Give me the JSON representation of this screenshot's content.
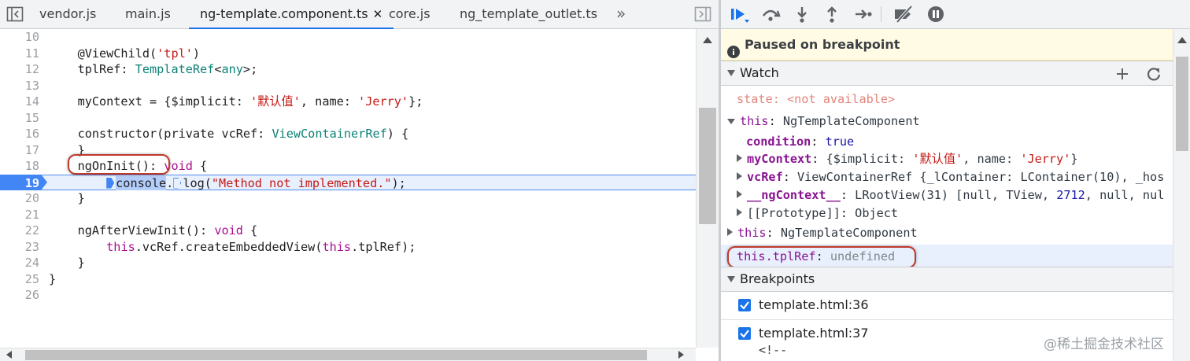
{
  "editor": {
    "tabs": [
      {
        "label": "vendor.js",
        "active": false
      },
      {
        "label": "main.js",
        "active": false
      },
      {
        "label": "ng-template.component.ts",
        "active": true
      },
      {
        "label": "core.js",
        "active": false
      },
      {
        "label": "ng_template_outlet.ts",
        "active": false
      }
    ],
    "tab_close_glyph": "✕",
    "more_tabs_glyph": "»",
    "lines": [
      {
        "n": "10"
      },
      {
        "n": "11"
      },
      {
        "n": "12"
      },
      {
        "n": "13"
      },
      {
        "n": "14"
      },
      {
        "n": "15"
      },
      {
        "n": "16"
      },
      {
        "n": "17"
      },
      {
        "n": "18"
      },
      {
        "n": "19"
      },
      {
        "n": "20"
      },
      {
        "n": "21"
      },
      {
        "n": "22"
      },
      {
        "n": "23"
      },
      {
        "n": "24"
      },
      {
        "n": "25"
      },
      {
        "n": "26"
      }
    ],
    "code": {
      "l11_a": "    @ViewChild(",
      "l11_b": "'tpl'",
      "l11_c": ")",
      "l12_a": "    tplRef: ",
      "l12_b": "TemplateRef",
      "l12_c": "<",
      "l12_d": "any",
      "l12_e": ">;",
      "l14_a": "    myContext = {$implicit: ",
      "l14_b": "'默认值'",
      "l14_c": ", name: ",
      "l14_d": "'Jerry'",
      "l14_e": "};",
      "l16_a": "    constructor(private vcRef: ",
      "l16_b": "ViewContainerRef",
      "l16_c": ") {",
      "l17": "    }",
      "l18_a": "    ngOnInit(): ",
      "l18_b": "void",
      "l18_c": " {",
      "l19_pre": "        ",
      "l19_a": "console",
      "l19_b": ".",
      "l19_c": "log(",
      "l19_d": "\"Method not implemented.\"",
      "l19_e": ");",
      "l20": "    }",
      "l22_a": "    ngAfterViewInit(): ",
      "l22_b": "void",
      "l22_c": " {",
      "l23_pre": "        ",
      "l23_a": "this",
      "l23_b": ".vcRef.createEmbeddedView(",
      "l23_c": "this",
      "l23_d": ".tplRef);",
      "l24": "    }",
      "l25": "}"
    },
    "current_line": "19"
  },
  "debugger": {
    "paused_text": "Paused on breakpoint",
    "watch_title": "Watch",
    "watch": {
      "state_name": "state",
      "state_value": "<not available>",
      "this1_name": "this",
      "this1_value": "NgTemplateComponent",
      "condition_name": "condition",
      "condition_value": "true",
      "mycontext_name": "myContext",
      "mycontext_a": "{$implicit: ",
      "mycontext_b": "'默认值'",
      "mycontext_c": ", name: ",
      "mycontext_d": "'Jerry'",
      "mycontext_e": "}",
      "vcref_name": "vcRef",
      "vcref_value": "ViewContainerRef {_lContainer: LContainer(10), _hos",
      "ngcontext_name": "__ngContext__",
      "ngcontext_a": "LRootView(31) [null, TView, ",
      "ngcontext_b": "2712",
      "ngcontext_c": ", null, nul",
      "proto_name": "[[Prototype]]",
      "proto_value": "Object",
      "this2_name": "this",
      "this2_value": "NgTemplateComponent",
      "tplref_name": "this.tplRef",
      "tplref_value": "undefined"
    },
    "breakpoints_title": "Breakpoints",
    "breakpoints": [
      {
        "label": "template.html:36",
        "checked": true
      },
      {
        "label": "template.html:37",
        "checked": true,
        "snippet": "<!--"
      }
    ]
  },
  "watermark": "@稀土掘金技术社区",
  "colors": {
    "accent": "#1a73e8",
    "breakpoint": "#4285f4",
    "paused_bg": "#fffbe5",
    "annotation": "#c0392b"
  }
}
